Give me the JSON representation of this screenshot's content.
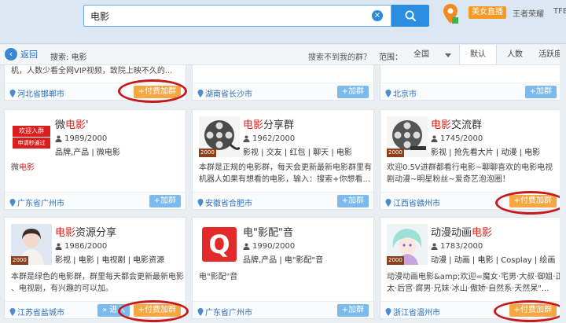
{
  "search": {
    "value": "电影"
  },
  "topbar": {
    "live_badge": "美女直播",
    "link1": "王者荣耀",
    "link2": "TFB"
  },
  "toolbar": {
    "back": "返回",
    "search_label": "搜索: 电影",
    "not_found": "搜索不到我的群？",
    "range_label": "范围：",
    "range_value": "全国",
    "sort_tabs": [
      "默认",
      "人数",
      "活跃度"
    ]
  },
  "top_row": {
    "c1_desc": "机，人数少看全网VIP视频，致院上映不久的...",
    "c1_loc": "河北省邯郸市",
    "c1_btn": "+付费加群",
    "c2_loc": "湖南省长沙市",
    "c2_btn": "+加群",
    "c3_loc": "北京市",
    "c3_btn": "+加群"
  },
  "cards": [
    {
      "title_hl_pre": "微",
      "title_hl": "电影",
      "title_post": "'",
      "count": "1989/2000",
      "tags": "品牌,产品  |  微电影",
      "desc_l1_pre": "微",
      "desc_l1_hl": "电影",
      "loc": "广东省广州市",
      "btn": "+加群",
      "logo_l1": "欢迎入群",
      "logo_l2": "申请秒通过"
    },
    {
      "title_hl": "电影",
      "title_post": "分享群",
      "count": "1962/2000",
      "tags": "影视  |  交友  |  红包  |  聊天  |  电影",
      "desc_l1": "本群是正规的电影群，每天会更新最新电影群里有",
      "desc_l2": "机器人如果有想看的电影，输入：搜索+你想看...",
      "loc": "安徽省合肥市",
      "btn": "+加群",
      "badge": "2000"
    },
    {
      "title_hl": "电影",
      "title_post": "交流群",
      "count": "1745/2000",
      "tags": "影视  |  抢先看大片  |  动漫  |  电影",
      "desc_l1": "欢迎0.5V进群都看行电影~聊聊喜欢的电影电视",
      "desc_l2": "剧动漫~明星粉丝~爱奇艺泡泡圈！",
      "loc": "江西省赣州市",
      "btn": "+付费加群",
      "badge": "2000"
    },
    {
      "title_hl": "电影",
      "title_post": "资源分享",
      "count": "1986/2000",
      "tags": "影视  |  电影  |  电视剧  |  电影资源",
      "desc_l1": "本群是绿色的电影群，群里每天都会更新最新电影",
      "desc_l2": "、电视剧，有兴趣的可以加。",
      "loc": "江苏省盐城市",
      "btn_enter": "» 进入",
      "btn": "+付费加群",
      "badge": "2000"
    },
    {
      "title": "电\"影配\"音",
      "count": "1990/2000",
      "tags": "品牌,产品  |  电\"影配\"音",
      "desc_l1": "电\"影配\"音",
      "loc": "广东省广州市",
      "btn": "+加群",
      "logo_letter": "Q"
    },
    {
      "title_pre": "动漫动画",
      "title_hl": "电影",
      "count": "1783/2000",
      "tags": "动漫  |  动画  |  电影  |  Cosplay  |  绘画",
      "desc_l1": "动漫动画电影&amp;欢迎=魔女·宅男·大叔·御姐·正",
      "desc_l2": "太·后宫·腐男·兄妹·冰山·傲娇·自然系·天然呆\"...",
      "loc": "浙江省温州市",
      "btn": "+付费加群",
      "badge": "2000"
    }
  ],
  "colors": {
    "accent": "#2b8ee0",
    "highlight": "#e0201b",
    "paid": "#f5a742",
    "ring": "#c6191d"
  }
}
